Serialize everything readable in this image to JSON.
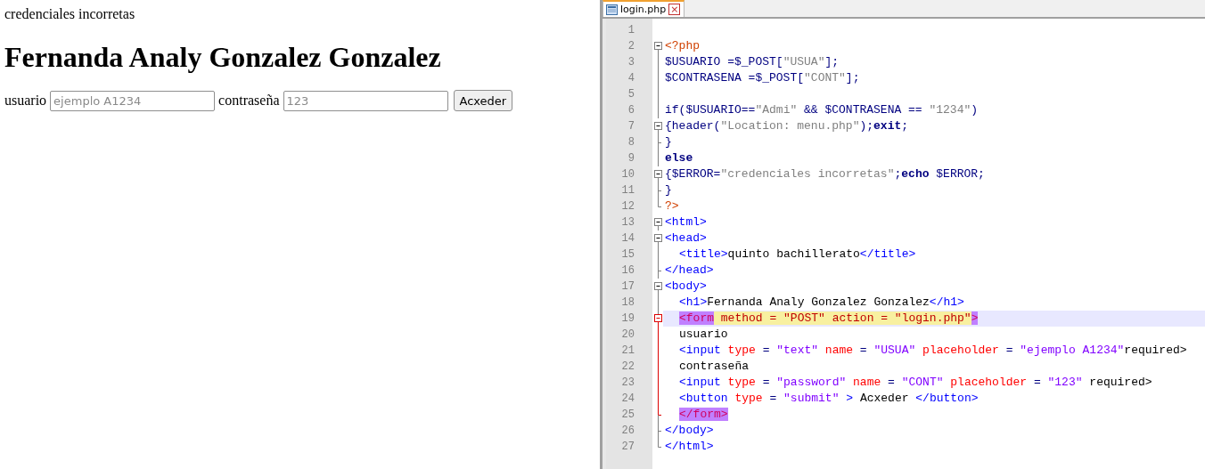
{
  "page": {
    "message": "credenciales incorretas",
    "heading": "Fernanda Analy Gonzalez Gonzalez",
    "form": {
      "user_label": "usuario",
      "user_field": {
        "placeholder": "ejemplo A1234"
      },
      "password_label": "contraseña",
      "password_field": {
        "placeholder": "123"
      },
      "submit_button": "Acxeder"
    }
  },
  "editor": {
    "tabs": [
      {
        "label": "login.php",
        "selected": true,
        "close": "×"
      }
    ],
    "lines": [
      {
        "number": "1",
        "kind": "plain",
        "highlighted": false
      },
      {
        "number": "2",
        "kind": "open",
        "highlighted": false,
        "indented": false,
        "tokens": [
          {
            "t": "<?php",
            "kind": "php"
          }
        ]
      },
      {
        "number": "3",
        "kind": "line",
        "highlighted": false,
        "indented": false,
        "tokens": [
          {
            "t": "$USUARIO =$_POST[",
            "kind": "plain"
          },
          {
            "t": "\"USUA\"",
            "kind": "string"
          },
          {
            "t": "];",
            "kind": "plain"
          }
        ]
      },
      {
        "number": "4",
        "kind": "line",
        "highlighted": false,
        "indented": false,
        "tokens": [
          {
            "t": "$CONTRASENA =$_POST[",
            "kind": "plain"
          },
          {
            "t": "\"CONT\"",
            "kind": "string"
          },
          {
            "t": "];",
            "kind": "plain"
          }
        ]
      },
      {
        "number": "5",
        "kind": "line",
        "highlighted": false
      },
      {
        "number": "6",
        "kind": "line",
        "highlighted": false,
        "indented": false,
        "tokens": [
          {
            "t": "if($USUARIO==",
            "kind": "plain"
          },
          {
            "t": "\"Admi\"",
            "kind": "string"
          },
          {
            "t": " && $CONTRASENA == ",
            "kind": "plain"
          },
          {
            "t": "\"1234\"",
            "kind": "string"
          },
          {
            "t": ")",
            "kind": "plain"
          }
        ]
      },
      {
        "number": "7",
        "kind": "open",
        "highlighted": false,
        "indented": false,
        "tokens": [
          {
            "t": "{header(",
            "kind": "plain"
          },
          {
            "t": "\"Location: menu.php\"",
            "kind": "string"
          },
          {
            "t": ");",
            "kind": "plain"
          },
          {
            "t": "exit",
            "kind": "keyword"
          },
          {
            "t": ";",
            "kind": "plain"
          }
        ]
      },
      {
        "number": "8",
        "kind": "end",
        "highlighted": false,
        "indented": false,
        "tokens": [
          {
            "t": "}",
            "kind": "plain"
          }
        ]
      },
      {
        "number": "9",
        "kind": "line",
        "highlighted": false,
        "indented": false,
        "tokens": [
          {
            "t": "else",
            "kind": "keyword"
          }
        ]
      },
      {
        "number": "10",
        "kind": "open",
        "highlighted": false,
        "indented": false,
        "tokens": [
          {
            "t": "{$ERROR=",
            "kind": "plain"
          },
          {
            "t": "\"credenciales incorretas\"",
            "kind": "string"
          },
          {
            "t": ";",
            "kind": "plain"
          },
          {
            "t": "echo",
            "kind": "keyword"
          },
          {
            "t": " $ERROR;",
            "kind": "plain"
          }
        ]
      },
      {
        "number": "11",
        "kind": "end",
        "highlighted": false,
        "indented": false,
        "tokens": [
          {
            "t": "}",
            "kind": "plain"
          }
        ]
      },
      {
        "number": "12",
        "kind": "last",
        "highlighted": false,
        "indented": false,
        "tokens": [
          {
            "t": "?>",
            "kind": "php"
          }
        ]
      },
      {
        "number": "13",
        "kind": "open",
        "highlighted": false,
        "indented": false,
        "tokens": [
          {
            "t": "<html>",
            "kind": "tag"
          }
        ]
      },
      {
        "number": "14",
        "kind": "open",
        "highlighted": false,
        "indented": false,
        "tokens": [
          {
            "t": "<head>",
            "kind": "tag"
          }
        ]
      },
      {
        "number": "15",
        "kind": "line",
        "highlighted": false,
        "indented": true,
        "tokens": [
          {
            "t": "<title>",
            "kind": "tag"
          },
          {
            "t": "quinto bachillerato",
            "kind": "text"
          },
          {
            "t": "</title>",
            "kind": "tag"
          }
        ]
      },
      {
        "number": "16",
        "kind": "end",
        "highlighted": false,
        "indented": false,
        "tokens": [
          {
            "t": "</head>",
            "kind": "tag"
          }
        ]
      },
      {
        "number": "17",
        "kind": "open",
        "highlighted": false,
        "indented": false,
        "tokens": [
          {
            "t": "<body>",
            "kind": "tag"
          }
        ]
      },
      {
        "number": "18",
        "kind": "line",
        "highlighted": false,
        "indented": true,
        "tokens": [
          {
            "t": "<h1>",
            "kind": "tag"
          },
          {
            "t": "Fernanda Analy Gonzalez Gonzalez",
            "kind": "text"
          },
          {
            "t": "</h1>",
            "kind": "tag"
          }
        ]
      },
      {
        "number": "19",
        "kind": "active",
        "highlighted": true,
        "indented": true,
        "tokens": [
          {
            "t": "<form",
            "kind": "match"
          },
          {
            "t": " method = \"POST\" action = \"login.php\"",
            "kind": "formattr"
          },
          {
            "t": ">",
            "kind": "match"
          }
        ]
      },
      {
        "number": "20",
        "kind": "activeline",
        "highlighted": false,
        "indented": true,
        "tokens": [
          {
            "t": "usuario",
            "kind": "text"
          }
        ]
      },
      {
        "number": "21",
        "kind": "activeline",
        "highlighted": false,
        "indented": true,
        "tokens": [
          {
            "t": "<input ",
            "kind": "tag"
          },
          {
            "t": "type",
            "kind": "attr"
          },
          {
            "t": " = ",
            "kind": "plain"
          },
          {
            "t": "\"text\"",
            "kind": "value"
          },
          {
            "t": " name",
            "kind": "attr"
          },
          {
            "t": " = ",
            "kind": "plain"
          },
          {
            "t": "\"USUA\"",
            "kind": "value"
          },
          {
            "t": " placeholder",
            "kind": "attr"
          },
          {
            "t": " = ",
            "kind": "plain"
          },
          {
            "t": "\"ejemplo A1234\"",
            "kind": "value"
          },
          {
            "t": "required>",
            "kind": "text"
          }
        ]
      },
      {
        "number": "22",
        "kind": "activeline",
        "highlighted": false,
        "indented": true,
        "tokens": [
          {
            "t": "contraseña",
            "kind": "text"
          }
        ]
      },
      {
        "number": "23",
        "kind": "activeline",
        "highlighted": false,
        "indented": true,
        "tokens": [
          {
            "t": "<input ",
            "kind": "tag"
          },
          {
            "t": "type",
            "kind": "attr"
          },
          {
            "t": " = ",
            "kind": "plain"
          },
          {
            "t": "\"password\"",
            "kind": "value"
          },
          {
            "t": " name",
            "kind": "attr"
          },
          {
            "t": " = ",
            "kind": "plain"
          },
          {
            "t": "\"CONT\"",
            "kind": "value"
          },
          {
            "t": " placeholder",
            "kind": "attr"
          },
          {
            "t": " = ",
            "kind": "plain"
          },
          {
            "t": "\"123\"",
            "kind": "value"
          },
          {
            "t": " required>",
            "kind": "text"
          }
        ]
      },
      {
        "number": "24",
        "kind": "activeline",
        "highlighted": false,
        "indented": true,
        "tokens": [
          {
            "t": "<button ",
            "kind": "tag"
          },
          {
            "t": "type",
            "kind": "attr"
          },
          {
            "t": " = ",
            "kind": "plain"
          },
          {
            "t": "\"submit\"",
            "kind": "value"
          },
          {
            "t": " > ",
            "kind": "tag"
          },
          {
            "t": "Acxeder",
            "kind": "text"
          },
          {
            "t": " </button>",
            "kind": "tag"
          }
        ]
      },
      {
        "number": "25",
        "kind": "activeend",
        "highlighted": false,
        "indented": true,
        "tokens": [
          {
            "t": "</form>",
            "kind": "match"
          }
        ]
      },
      {
        "number": "26",
        "kind": "end",
        "highlighted": false,
        "indented": false,
        "tokens": [
          {
            "t": "</body>",
            "kind": "tag"
          }
        ]
      },
      {
        "number": "27",
        "kind": "last",
        "highlighted": false,
        "indented": false,
        "tokens": [
          {
            "t": "</html>",
            "kind": "tag"
          }
        ]
      }
    ]
  }
}
